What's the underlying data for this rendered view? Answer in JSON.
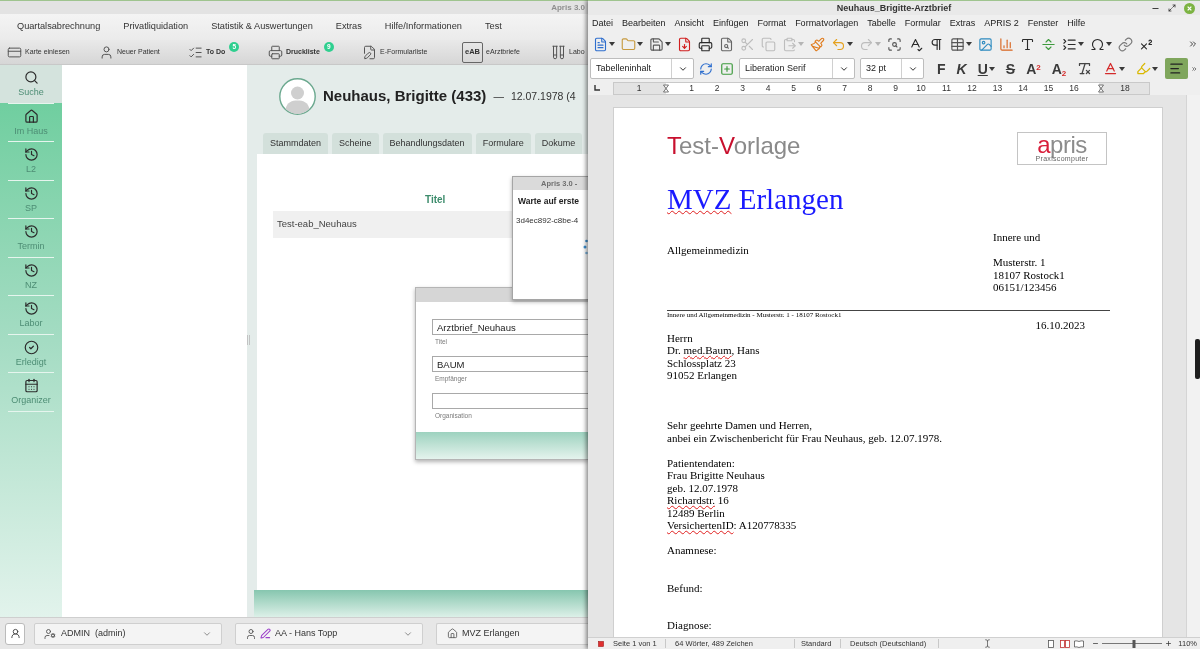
{
  "apris": {
    "title": "Apris 3.0",
    "menu": [
      "Quartalsabrechnung",
      "Privatliquidation",
      "Statistik & Auswertungen",
      "Extras",
      "Hilfe/Informationen",
      "Test"
    ],
    "toolbar": [
      {
        "kind": "card",
        "label": "Karte einlesen"
      },
      {
        "kind": "person",
        "label": "Neuer Patient"
      },
      {
        "kind": "checklist",
        "label": "To Do",
        "badge": "5"
      },
      {
        "kind": "printer",
        "label": "Druckliste",
        "badge": "9"
      },
      {
        "kind": "form",
        "label": "E-Formularliste"
      },
      {
        "kind": "eab",
        "icon_text": "eAB",
        "label": "eArztbriefe"
      },
      {
        "kind": "tubes",
        "label": "Labo"
      }
    ],
    "sidebar": [
      {
        "kind": "search",
        "label": "Suche",
        "selected": true
      },
      {
        "kind": "home",
        "label": "Im Haus",
        "selected": false
      },
      {
        "kind": "history",
        "label": "L2",
        "selected": false
      },
      {
        "kind": "history",
        "label": "SP",
        "selected": false
      },
      {
        "kind": "history",
        "label": "Termin",
        "selected": false
      },
      {
        "kind": "history",
        "label": "NZ",
        "selected": false
      },
      {
        "kind": "history",
        "label": "Labor",
        "selected": false
      },
      {
        "kind": "done",
        "label": "Erledigt",
        "selected": false
      },
      {
        "kind": "calendar",
        "label": "Organizer",
        "selected": false
      }
    ],
    "patient": {
      "name": "Neuhaus, Brigitte (433)",
      "separator": "—",
      "birth": "12.07.1978 (4"
    },
    "tabs": [
      {
        "label": "Stammdaten",
        "selected": false
      },
      {
        "label": "Scheine",
        "selected": false
      },
      {
        "label": "Behandlungsdaten",
        "selected": false
      },
      {
        "label": "Formulare",
        "selected": false
      },
      {
        "label": "Dokume",
        "selected": false
      }
    ],
    "table": {
      "columns": [
        "Titel"
      ],
      "rows": [
        [
          "Test-eab_Neuhaus"
        ]
      ]
    },
    "wait_dialog": {
      "title": "Apris 3.0 -",
      "heading": "Warte auf erste",
      "id": "3d4ec892-c8be-4"
    },
    "form_dialog": {
      "fields": [
        {
          "label": "Titel",
          "value": "Arztbrief_Neuhaus"
        },
        {
          "label": "Empfänger",
          "value": "BAUM"
        },
        {
          "label": "Organisation"
        }
      ]
    },
    "status_bar": {
      "user": "ADMIN  (admin)",
      "doctor": "AA - Hans Topp",
      "location": "MVZ Erlangen"
    }
  },
  "writer": {
    "title": "Neuhaus_Brigitte-Arztbrief",
    "menu": [
      "Datei",
      "Bearbeiten",
      "Ansicht",
      "Einfügen",
      "Format",
      "Formatvorlagen",
      "Tabelle",
      "Formular",
      "Extras",
      "APRIS 2",
      "Fenster",
      "Hilfe"
    ],
    "standard_toolbar": [
      {
        "kind": "new",
        "disabled": false,
        "dropdown": true
      },
      {
        "kind": "open",
        "disabled": false,
        "dropdown": true
      },
      {
        "kind": "save",
        "disabled": false,
        "dropdown": true
      },
      {
        "kind": "export-pdf",
        "disabled": false,
        "dropdown": false
      },
      {
        "kind": "print",
        "disabled": false,
        "dropdown": false
      },
      {
        "kind": "print-preview",
        "disabled": false,
        "dropdown": false
      },
      {
        "kind": "cut",
        "disabled": true,
        "dropdown": false
      },
      {
        "kind": "copy",
        "disabled": true,
        "dropdown": false
      },
      {
        "kind": "paste",
        "disabled": true,
        "dropdown": true
      },
      {
        "kind": "clone-formatting",
        "disabled": false,
        "dropdown": false
      },
      {
        "kind": "undo",
        "disabled": false,
        "dropdown": true
      },
      {
        "kind": "redo",
        "disabled": true,
        "dropdown": true
      },
      {
        "kind": "find-replace",
        "disabled": false,
        "dropdown": false
      },
      {
        "kind": "spellcheck",
        "disabled": false,
        "dropdown": false
      },
      {
        "kind": "formatting-marks",
        "disabled": false,
        "dropdown": false
      },
      {
        "kind": "table",
        "disabled": false,
        "dropdown": true
      },
      {
        "kind": "image",
        "disabled": false,
        "dropdown": false
      },
      {
        "kind": "chart",
        "disabled": false,
        "dropdown": false
      },
      {
        "kind": "text-box",
        "disabled": false,
        "dropdown": false
      },
      {
        "kind": "page-break",
        "disabled": false,
        "dropdown": false
      },
      {
        "kind": "field",
        "disabled": false,
        "dropdown": true
      },
      {
        "kind": "special-character",
        "disabled": false,
        "dropdown": true
      },
      {
        "kind": "hyperlink",
        "disabled": false,
        "dropdown": false
      },
      {
        "kind": "footnote",
        "disabled": false,
        "dropdown": false
      }
    ],
    "formatting_toolbar": {
      "paragraph_style": "Tabelleninhalt",
      "font_name": "Liberation Serif",
      "font_size": "32 pt",
      "buttons": [
        {
          "kind": "bold",
          "label": "F",
          "selected": false,
          "dropdown": false
        },
        {
          "kind": "italic",
          "label": "K",
          "selected": false,
          "dropdown": false
        },
        {
          "kind": "underline",
          "label": "U",
          "selected": false,
          "dropdown": true
        },
        {
          "kind": "strikethrough",
          "label": "S",
          "selected": false,
          "dropdown": false
        },
        {
          "kind": "superscript",
          "label": "A$^{2}$",
          "selected": false,
          "dropdown": false
        },
        {
          "kind": "subscript",
          "label": "A$_{2}$",
          "selected": false,
          "dropdown": false
        },
        {
          "kind": "clear-formatting",
          "selected": false,
          "dropdown": false
        },
        {
          "kind": "font-color",
          "selected": false,
          "dropdown": true
        },
        {
          "kind": "highlight",
          "selected": false,
          "dropdown": true
        },
        {
          "kind": "align-left",
          "selected": true,
          "dropdown": false
        }
      ]
    },
    "ruler": {
      "labels": [
        "1",
        "1",
        "2",
        "3",
        "4",
        "5",
        "6",
        "7",
        "8",
        "9",
        "10",
        "11",
        "12",
        "13",
        "14",
        "15",
        "16",
        "18"
      ]
    },
    "document": {
      "heading": [
        {
          "text": "T",
          "accent": true
        },
        {
          "text": "est-",
          "accent": false
        },
        {
          "text": "V",
          "accent": true
        },
        {
          "text": "orlage",
          "accent": false
        }
      ],
      "logo": {
        "parts": [
          {
            "text": "a",
            "accent": true
          },
          {
            "text": "pris",
            "accent": false
          }
        ],
        "tagline": "Praxiscomputer"
      },
      "practice_name": [
        {
          "text": "MVZ",
          "misspelled": true
        },
        {
          "text": " Erlangen",
          "misspelled": false
        }
      ],
      "specialty": "Allgemeinmedizin",
      "department": "Innere und",
      "sender_address": [
        "Musterstr. 1",
        "18107 Rostock1",
        "06151/123456"
      ],
      "sender_line": "Innere und Allgemeinmedizin - Musterstr. 1 - 18107 Rostock1",
      "date": "16.10.2023",
      "recipient": [
        [
          {
            "text": "Herrn",
            "misspelled": false
          }
        ],
        [
          {
            "text": "Dr. ",
            "misspelled": false
          },
          {
            "text": "med.Baum",
            "misspelled": true
          },
          {
            "text": ", Hans",
            "misspelled": false
          }
        ],
        [
          {
            "text": "Schlossplatz 23",
            "misspelled": false
          }
        ],
        [
          {
            "text": "91052 Erlangen",
            "misspelled": false
          }
        ]
      ],
      "salutation": [
        "Sehr geehrte Damen und Herren,",
        "anbei ein Zwischenbericht für Frau Neuhaus, geb. 12.07.1978."
      ],
      "patient_data": [
        [
          {
            "text": "Patientendaten:",
            "misspelled": false
          }
        ],
        [
          {
            "text": "Frau Brigitte Neuhaus",
            "misspelled": false
          }
        ],
        [
          {
            "text": "geb. 12.07.1978",
            "misspelled": false
          }
        ],
        [
          {
            "text": "Richardstr.",
            "misspelled": true
          },
          {
            "text": " 16",
            "misspelled": false
          }
        ],
        [
          {
            "text": "12489 Berlin",
            "misspelled": false
          }
        ],
        [
          {
            "text": "VersichertenID",
            "misspelled": true
          },
          {
            "text": ": A120778335",
            "misspelled": false
          }
        ]
      ],
      "sections": [
        "Anamnese:",
        "Befund:",
        "Diagnose:"
      ]
    },
    "status_bar": {
      "page": "Seite 1 von 1",
      "words": "64 Wörter, 489 Zeichen",
      "page_style": "Standard",
      "language": "Deutsch (Deutschland)",
      "zoom": {
        "level": 0.52,
        "reading": "110%"
      }
    }
  }
}
